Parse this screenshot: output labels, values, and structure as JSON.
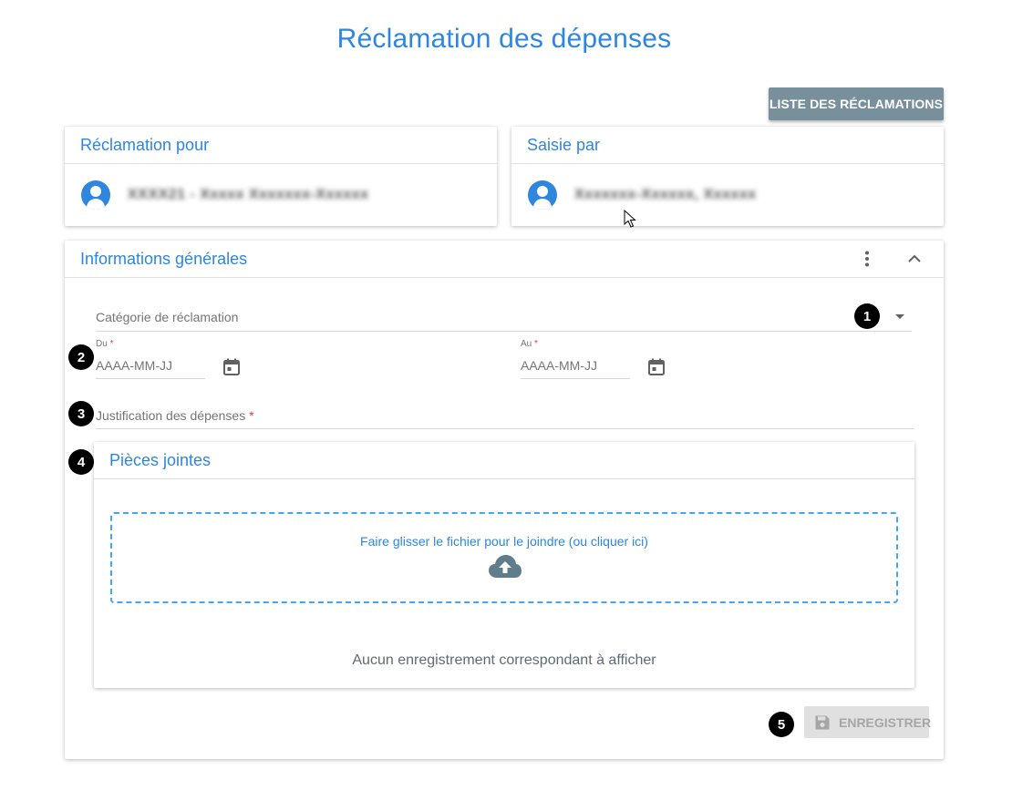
{
  "page": {
    "title": "Réclamation des dépenses"
  },
  "toolbar": {
    "list_button_label": "LISTE DES RÉCLAMATIONS"
  },
  "claim_for": {
    "title": "Réclamation pour",
    "person_name": "XXXX21 - Xxxxx Xxxxxxx-Xxxxxx"
  },
  "entered_by": {
    "title": "Saisie par",
    "person_name": "Xxxxxxx-Xxxxxx, Xxxxxx"
  },
  "general_info": {
    "title": "Informations générales",
    "category": {
      "placeholder": "Catégorie de réclamation"
    },
    "from": {
      "label": "Du",
      "required_mark": "*",
      "placeholder": "AAAA-MM-JJ"
    },
    "to": {
      "label": "Au",
      "required_mark": "*",
      "placeholder": "AAAA-MM-JJ"
    },
    "justification": {
      "label": "Justification des dépenses",
      "required_mark": "*"
    }
  },
  "attachments": {
    "title": "Pièces jointes",
    "dropzone_text": "Faire glisser le fichier pour le joindre (ou cliquer ici)",
    "empty_text": "Aucun enregistrement correspondant à afficher"
  },
  "actions": {
    "save_label": "ENREGISTRER"
  },
  "callouts": {
    "b1": "1",
    "b2": "2",
    "b3": "3",
    "b4": "4",
    "b5": "5"
  },
  "icons": {
    "avatar": "account-circle-icon",
    "more": "more-vert-icon",
    "collapse": "chevron-up-icon",
    "dropdown": "arrow-drop-down-icon",
    "calendar": "calendar-icon",
    "upload": "cloud-upload-icon",
    "save": "floppy-disk-icon"
  },
  "colors": {
    "primary": "#2e86de",
    "list_button": "#78909c",
    "dropzone_border": "#42a5f5",
    "required": "#e53935",
    "disabled_bg": "#e0e0e0"
  }
}
